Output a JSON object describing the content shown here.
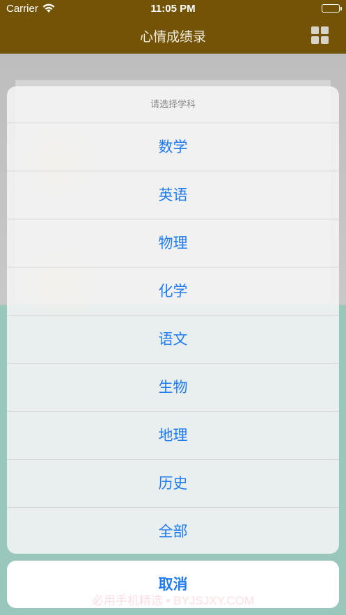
{
  "status_bar": {
    "carrier": "Carrier",
    "time": "11:05 PM",
    "wifi_icon": "wifi-icon",
    "battery_icon": "battery-icon"
  },
  "nav": {
    "title": "心情成绩录",
    "menu_icon": "grid-icon"
  },
  "action_sheet": {
    "title": "请选择学科",
    "options": [
      "数学",
      "英语",
      "物理",
      "化学",
      "语文",
      "生物",
      "地理",
      "历史",
      "全部"
    ],
    "cancel_label": "取消"
  },
  "watermark": "必用手机精选 • BYJSJXY.COM",
  "colors": {
    "nav_bar": "#735406",
    "action_text": "#1f7bf2",
    "background_teal": "#a8d8cc"
  }
}
